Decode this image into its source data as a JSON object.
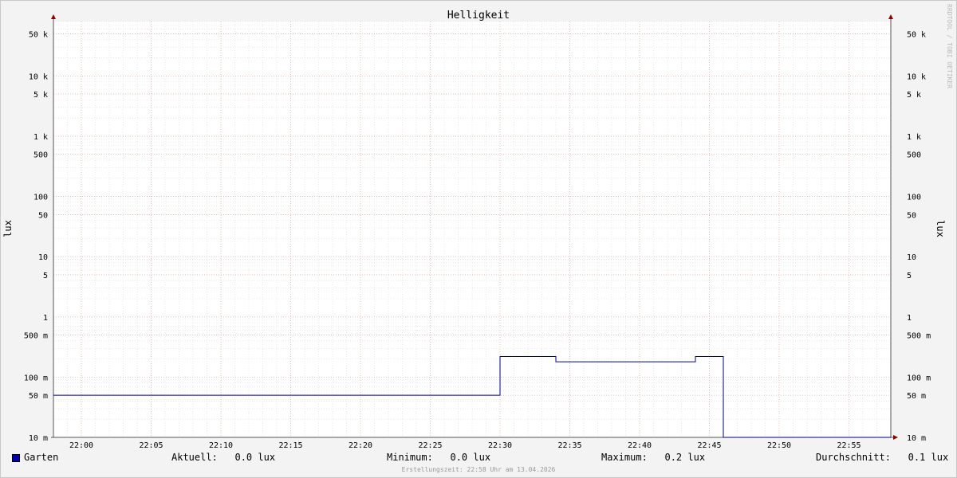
{
  "chart_data": {
    "type": "line",
    "title": "Helligkeit",
    "ylabel": "lux",
    "y_scale": "log",
    "ylim": [
      10,
      80000
    ],
    "x_ticks": [
      "22:00",
      "22:05",
      "22:10",
      "22:15",
      "22:20",
      "22:25",
      "22:30",
      "22:35",
      "22:40",
      "22:45",
      "22:50",
      "22:55"
    ],
    "y_ticks": [
      {
        "value": 10,
        "label": "10 m"
      },
      {
        "value": 50,
        "label": "50 m"
      },
      {
        "value": 100,
        "label": "100 m"
      },
      {
        "value": 500,
        "label": "500 m"
      },
      {
        "value": 1000,
        "label": "1"
      },
      {
        "value": 5000,
        "label": "5"
      },
      {
        "value": 10000,
        "label": "10"
      },
      {
        "value": 50000,
        "label": "50"
      },
      {
        "value": 100000,
        "label": "100"
      },
      {
        "value": 500000,
        "label": "500"
      },
      {
        "value": 1000000,
        "label": "1 k"
      },
      {
        "value": 5000000,
        "label": "5 k"
      },
      {
        "value": 10000000,
        "label": "10 k"
      },
      {
        "value": 50000000,
        "label": "50 k"
      }
    ],
    "series": [
      {
        "name": "Garten",
        "color": "#000080",
        "x": [
          "21:58",
          "22:30",
          "22:30",
          "22:34",
          "22:34",
          "22:44",
          "22:44",
          "22:46",
          "22:46",
          "22:58"
        ],
        "values": [
          50,
          50,
          220,
          220,
          180,
          180,
          220,
          220,
          10,
          10
        ]
      }
    ],
    "grid": true,
    "legend_placement": "bottom"
  },
  "legend": {
    "series_name": "Garten",
    "aktuell": "Aktuell:   0.0 lux",
    "minimum": "Minimum:   0.0 lux",
    "maximum": "Maximum:   0.2 lux",
    "durchschnitt": "Durchschnitt:   0.1 lux"
  },
  "footer": "Erstellungszeit: 22:58 Uhr am 13.04.2026",
  "watermark": "RRDTOOL / TOBI OETIKER"
}
